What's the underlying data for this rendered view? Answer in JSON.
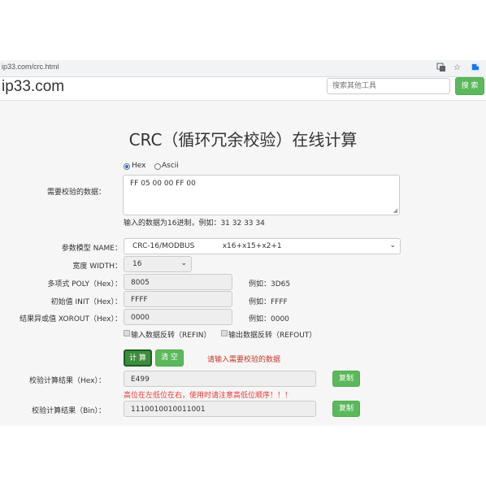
{
  "browser": {
    "url": "ip33.com/crc.html",
    "icons": [
      "translate-icon",
      "star-icon",
      "extension-icon"
    ]
  },
  "header": {
    "logo": "ip33.com",
    "search_placeholder": "搜索其他工具",
    "search_button": "搜 索"
  },
  "page": {
    "title": "CRC（循环冗余校验）在线计算"
  },
  "input": {
    "format_options": [
      {
        "label": "Hex",
        "selected": true
      },
      {
        "label": "Ascii",
        "selected": false
      }
    ],
    "data_label": "需要校验的数据：",
    "data_value": "FF 05 00 00 FF 00",
    "hint": "输入的数据为16进制，例如：31 32 33 34"
  },
  "params": {
    "model_label": "参数模型 NAME：",
    "model_value": "CRC-16/MODBUS            x16+x15+x2+1",
    "width_label": "宽度 WIDTH：",
    "width_value": "16",
    "poly_label": "多项式 POLY（Hex）：",
    "poly_value": "8005",
    "poly_example": "例如：3D65",
    "init_label": "初始值 INIT（Hex）：",
    "init_value": "FFFF",
    "init_example": "例如：FFFF",
    "xorout_label": "结果异或值 XOROUT（Hex）：",
    "xorout_value": "0000",
    "xorout_example": "例如：0000",
    "refin_label": "输入数据反转（REFIN）",
    "refout_label": "输出数据反转（REFOUT）"
  },
  "actions": {
    "calc_button": "计 算",
    "clear_button": "清 空",
    "message": "请输入需要校验的数据",
    "message_color": "#c0392b"
  },
  "results": {
    "hex_label": "校验计算结果（Hex）：",
    "hex_value": "E499",
    "hex_note": "高位在左低位在右，使用时请注意高低位顺序！！！",
    "bin_label": "校验计算结果（Bin）：",
    "bin_value": "1110010010011001",
    "copy_label": "复制"
  },
  "colors": {
    "accent_green": "#5cb85c",
    "calc_dark_green": "#2e7d32",
    "warning_red": "#e53935"
  }
}
